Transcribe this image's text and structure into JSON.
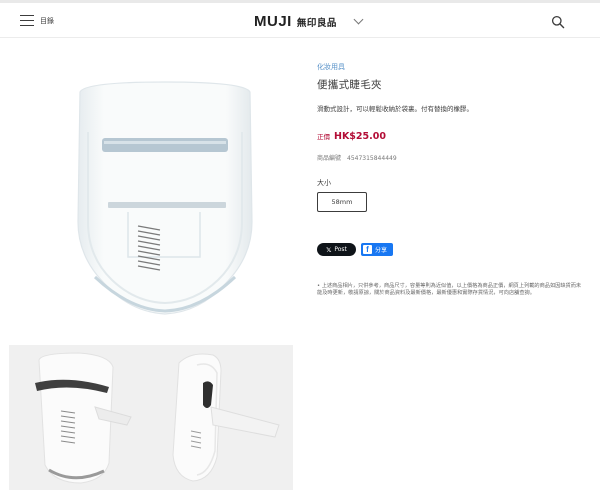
{
  "header": {
    "menu_label": "目錄",
    "logo_latin": "MUJI",
    "logo_cjk": "無印良品"
  },
  "product": {
    "category": "化妝用具",
    "title": "便攜式睫毛夾",
    "description": "滑動式設計，可以輕鬆收納於袋裏。付有替換的橡膠。",
    "price_label": "正價",
    "price": "HK$25.00",
    "sku_label": "商品編號",
    "sku_value": "4547315844449",
    "size_label": "大小",
    "size_value": "58mm"
  },
  "share": {
    "x_label": "Post",
    "fb_label": "分享"
  },
  "notes": "• 上述商品相片，只供參考，商品尺寸，容量等則為近似值，以上價格為商品正價，網頁上列載的商品如因缺貨而未能及時更新，敬請原諒，關於商品資料及最新價格，最新優惠和實際存貨情況，可向店舖查詢。",
  "colors": {
    "price": "#b30d36",
    "category_link": "#5a93c9",
    "x_button": "#0f1419",
    "fb_button": "#1877f2"
  },
  "icons": [
    "hamburger-menu-icon",
    "chevron-down-icon",
    "search-icon",
    "x-logo-icon",
    "facebook-icon"
  ]
}
